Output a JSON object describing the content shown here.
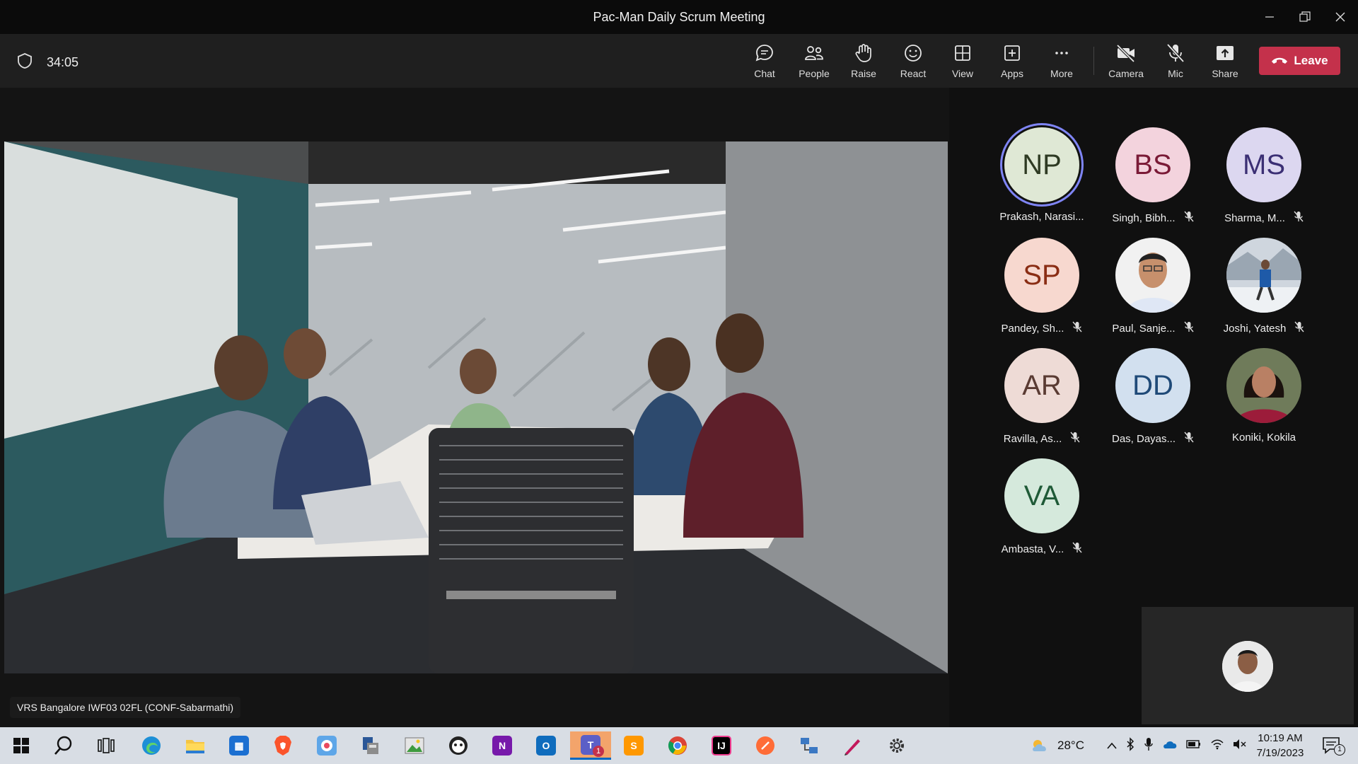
{
  "window": {
    "title": "Pac-Man Daily Scrum Meeting"
  },
  "toolbar": {
    "timer": "34:05",
    "buttons": {
      "chat": "Chat",
      "people": "People",
      "raise": "Raise",
      "react": "React",
      "view": "View",
      "apps": "Apps",
      "more": "More",
      "camera": "Camera",
      "mic": "Mic",
      "share": "Share"
    },
    "leave": "Leave"
  },
  "stage": {
    "room_label": "VRS Bangalore IWF03 02FL (CONF-Sabarmathi)"
  },
  "participants": [
    {
      "initials": "NP",
      "name": "Prakash, Narasi...",
      "muted": false,
      "speaking": true,
      "bg": "#dfe8d5",
      "fg": "#2e3a23"
    },
    {
      "initials": "BS",
      "name": "Singh, Bibh...",
      "muted": true,
      "bg": "#f3d3dd",
      "fg": "#7a1a36"
    },
    {
      "initials": "MS",
      "name": "Sharma, M...",
      "muted": true,
      "bg": "#dcd7f0",
      "fg": "#3b2f74"
    },
    {
      "initials": "SP",
      "name": "Pandey, Sh...",
      "muted": true,
      "bg": "#f7d8cf",
      "fg": "#8a2d14"
    },
    {
      "initials": "",
      "name": "Paul, Sanje...",
      "muted": true,
      "photo": "man-portrait"
    },
    {
      "initials": "",
      "name": "Joshi, Yatesh",
      "muted": true,
      "photo": "snow-portrait"
    },
    {
      "initials": "AR",
      "name": "Ravilla, As...",
      "muted": true,
      "bg": "#eedbd6",
      "fg": "#5a3b33"
    },
    {
      "initials": "DD",
      "name": "Das, Dayas...",
      "muted": true,
      "bg": "#d2e0ef",
      "fg": "#1f4a78"
    },
    {
      "initials": "",
      "name": "Koniki, Kokila",
      "muted": false,
      "photo": "woman-portrait"
    },
    {
      "initials": "VA",
      "name": "Ambasta, V...",
      "muted": true,
      "bg": "#d5e9dc",
      "fg": "#1f5a37"
    }
  ],
  "taskbar": {
    "weather": "28°C",
    "time": "10:19 AM",
    "date": "7/19/2023",
    "teams_badge": "1",
    "notification_badge": "1"
  },
  "colors": {
    "leave": "#c4314b",
    "speaking_ring": "#7f85f5",
    "toolbar": "#1f1f1f"
  }
}
